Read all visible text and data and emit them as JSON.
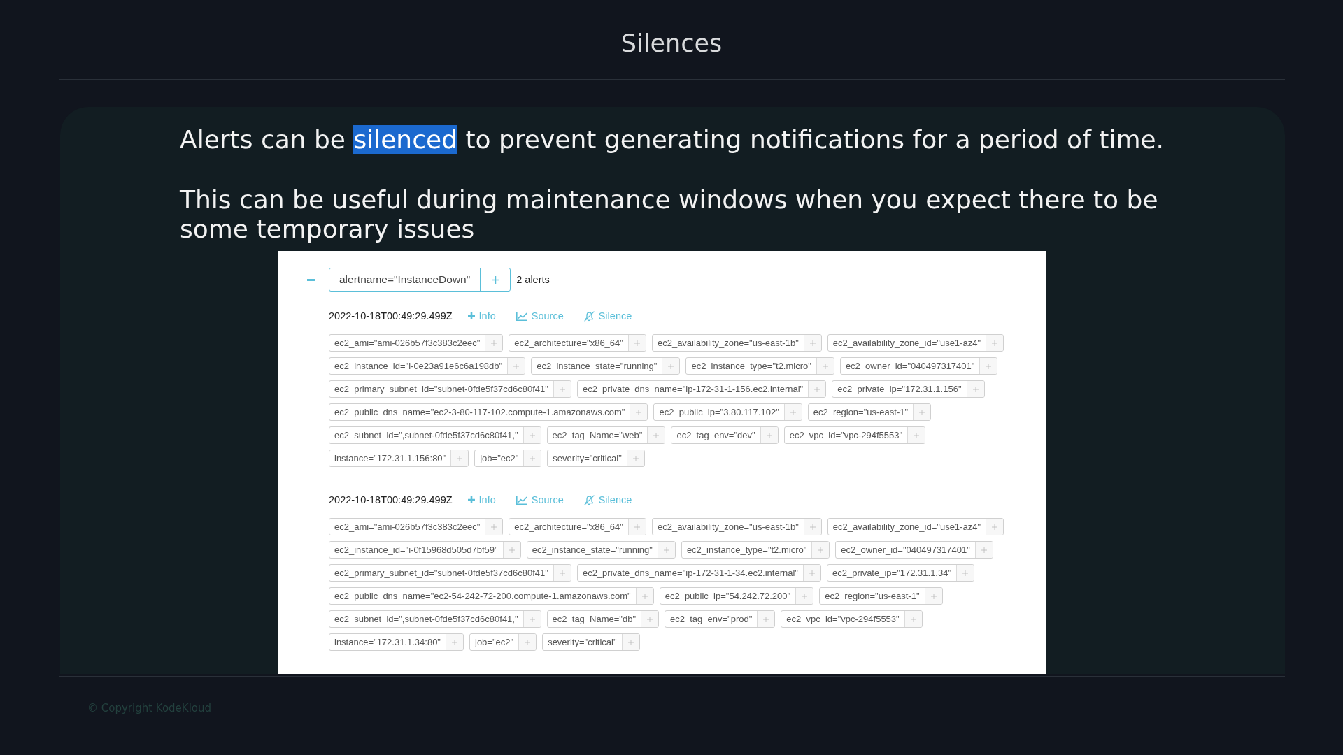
{
  "slide": {
    "title": "Silences"
  },
  "paragraphs": [
    {
      "segments": [
        {
          "text": "Alerts can be ",
          "highlighted": false
        },
        {
          "text": "silenced",
          "highlighted": true
        },
        {
          "text": " to prevent generating notifications for a period of time.",
          "highlighted": false
        }
      ]
    },
    {
      "segments": [
        {
          "text": "This can be useful during maintenance windows when you expect there to be some temporary issues",
          "highlighted": false
        }
      ]
    }
  ],
  "alert_group": {
    "expanded": true,
    "filter_label": "alertname=\"InstanceDown\"",
    "count": "2 alerts",
    "alerts": [
      {
        "timestamp": "2022-10-18T00:49:29.499Z",
        "actions": [
          {
            "kind": "info",
            "label": "Info"
          },
          {
            "kind": "source",
            "label": "Source"
          },
          {
            "kind": "silence",
            "label": "Silence"
          }
        ],
        "labels": [
          "ec2_ami=\"ami-026b57f3c383c2eec\"",
          "ec2_architecture=\"x86_64\"",
          "ec2_availability_zone=\"us-east-1b\"",
          "ec2_availability_zone_id=\"use1-az4\"",
          "ec2_instance_id=\"i-0e23a91e6c6a198db\"",
          "ec2_instance_state=\"running\"",
          "ec2_instance_type=\"t2.micro\"",
          "ec2_owner_id=\"040497317401\"",
          "ec2_primary_subnet_id=\"subnet-0fde5f37cd6c80f41\"",
          "ec2_private_dns_name=\"ip-172-31-1-156.ec2.internal\"",
          "ec2_private_ip=\"172.31.1.156\"",
          "ec2_public_dns_name=\"ec2-3-80-117-102.compute-1.amazonaws.com\"",
          "ec2_public_ip=\"3.80.117.102\"",
          "ec2_region=\"us-east-1\"",
          "ec2_subnet_id=\",subnet-0fde5f37cd6c80f41,\"",
          "ec2_tag_Name=\"web\"",
          "ec2_tag_env=\"dev\"",
          "ec2_vpc_id=\"vpc-294f5553\"",
          "instance=\"172.31.1.156:80\"",
          "job=\"ec2\"",
          "severity=\"critical\""
        ]
      },
      {
        "timestamp": "2022-10-18T00:49:29.499Z",
        "actions": [
          {
            "kind": "info",
            "label": "Info"
          },
          {
            "kind": "source",
            "label": "Source"
          },
          {
            "kind": "silence",
            "label": "Silence"
          }
        ],
        "labels": [
          "ec2_ami=\"ami-026b57f3c383c2eec\"",
          "ec2_architecture=\"x86_64\"",
          "ec2_availability_zone=\"us-east-1b\"",
          "ec2_availability_zone_id=\"use1-az4\"",
          "ec2_instance_id=\"i-0f15968d505d7bf59\"",
          "ec2_instance_state=\"running\"",
          "ec2_instance_type=\"t2.micro\"",
          "ec2_owner_id=\"040497317401\"",
          "ec2_primary_subnet_id=\"subnet-0fde5f37cd6c80f41\"",
          "ec2_private_dns_name=\"ip-172-31-1-34.ec2.internal\"",
          "ec2_private_ip=\"172.31.1.34\"",
          "ec2_public_dns_name=\"ec2-54-242-72-200.compute-1.amazonaws.com\"",
          "ec2_public_ip=\"54.242.72.200\"",
          "ec2_region=\"us-east-1\"",
          "ec2_subnet_id=\",subnet-0fde5f37cd6c80f41,\"",
          "ec2_tag_Name=\"db\"",
          "ec2_tag_env=\"prod\"",
          "ec2_vpc_id=\"vpc-294f5553\"",
          "instance=\"172.31.1.34:80\"",
          "job=\"ec2\"",
          "severity=\"critical\""
        ]
      }
    ]
  },
  "footer": {
    "copyright": "© Copyright KodeKloud"
  }
}
